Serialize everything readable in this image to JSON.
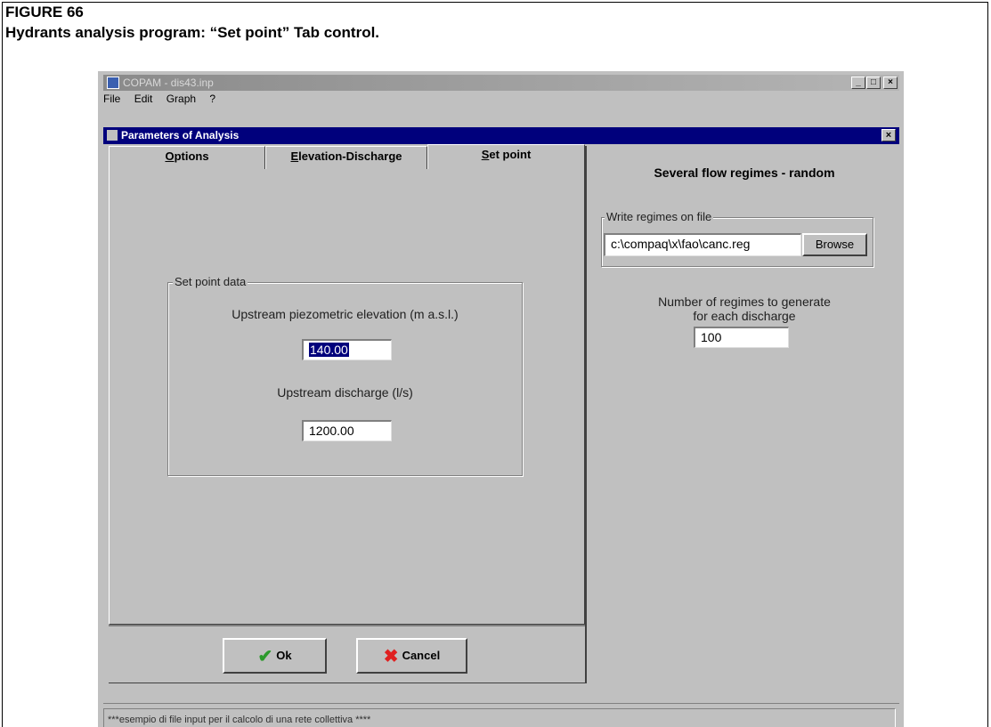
{
  "figure": {
    "label": "FIGURE 66",
    "caption": "Hydrants analysis program: “Set point” Tab control."
  },
  "app": {
    "title": "COPAM - dis43.inp",
    "menu": [
      "File",
      "Edit",
      "Graph",
      "?"
    ],
    "window_controls": {
      "minimize": "_",
      "maximize": "□",
      "close": "×"
    }
  },
  "dialog": {
    "title": "Parameters of Analysis",
    "close": "×"
  },
  "tabs": [
    {
      "label": "Options",
      "active": false
    },
    {
      "label": "Elevation-Discharge",
      "active": false
    },
    {
      "label": "Set point",
      "active": true
    }
  ],
  "set_point": {
    "group_label": "Set point data",
    "elevation_label": "Upstream piezometric elevation (m a.s.l.)",
    "elevation_value": "140.00",
    "discharge_label": "Upstream discharge (l/s)",
    "discharge_value": "1200.00"
  },
  "buttons": {
    "ok": "Ok",
    "cancel": "Cancel"
  },
  "right_panel": {
    "title": "Several flow regimes - random",
    "write_group_label": "Write regimes on file",
    "file_path": "c:\\compaq\\x\\fao\\canc.reg",
    "browse": "Browse",
    "regimes_label_line1": "Number of regimes to generate",
    "regimes_label_line2": "for each discharge",
    "regimes_value": "100"
  },
  "status_bar": {
    "text": "***esempio di file input per il calcolo di una rete collettiva ****"
  },
  "colors": {
    "dialog_title_bar": "#00007c",
    "window_face": "#c0c0c0",
    "selection": "#00007c",
    "ok_check": "#2c9a2c",
    "cancel_x": "#e02020"
  }
}
